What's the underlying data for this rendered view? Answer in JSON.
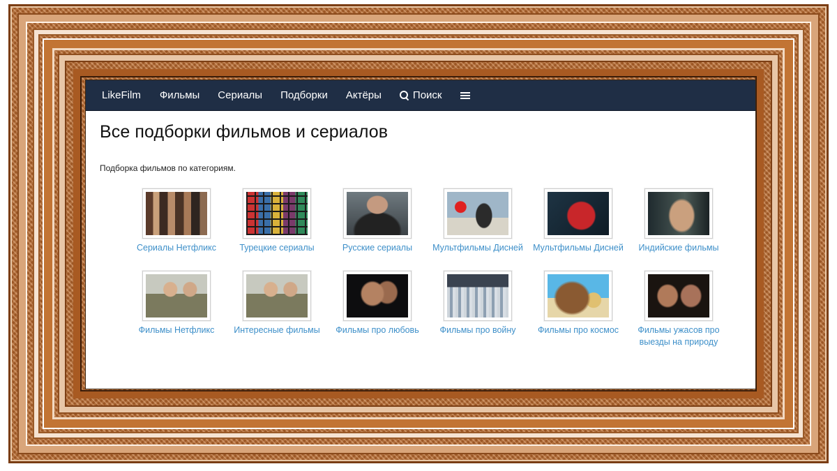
{
  "navbar": {
    "brand": "LikeFilm",
    "items": [
      {
        "label": "Фильмы"
      },
      {
        "label": "Сериалы"
      },
      {
        "label": "Подборки"
      },
      {
        "label": "Актёры"
      },
      {
        "label": "Поиск",
        "icon": "search-icon"
      }
    ],
    "menu_icon": "menu-icon"
  },
  "page": {
    "title": "Все подборки фильмов и сериалов",
    "subtitle": "Подборка фильмов по категориям."
  },
  "categories": [
    {
      "label": "Сериалы Нетфликс"
    },
    {
      "label": "Турецкие сериалы"
    },
    {
      "label": "Русские сериалы"
    },
    {
      "label": "Мультфильмы Дисней"
    },
    {
      "label": "Мультфильмы Дисней"
    },
    {
      "label": "Индийские фильмы"
    },
    {
      "label": "Фильмы Нетфликс"
    },
    {
      "label": "Интересные фильмы"
    },
    {
      "label": "Фильмы про любовь"
    },
    {
      "label": "Фильмы про войну"
    },
    {
      "label": "Фильмы про космос"
    },
    {
      "label": "Фильмы ужасов про выезды на природу"
    }
  ],
  "colors": {
    "navbar": "#1f2e45",
    "link": "#3d8fc9",
    "frame": "#b8682c"
  }
}
